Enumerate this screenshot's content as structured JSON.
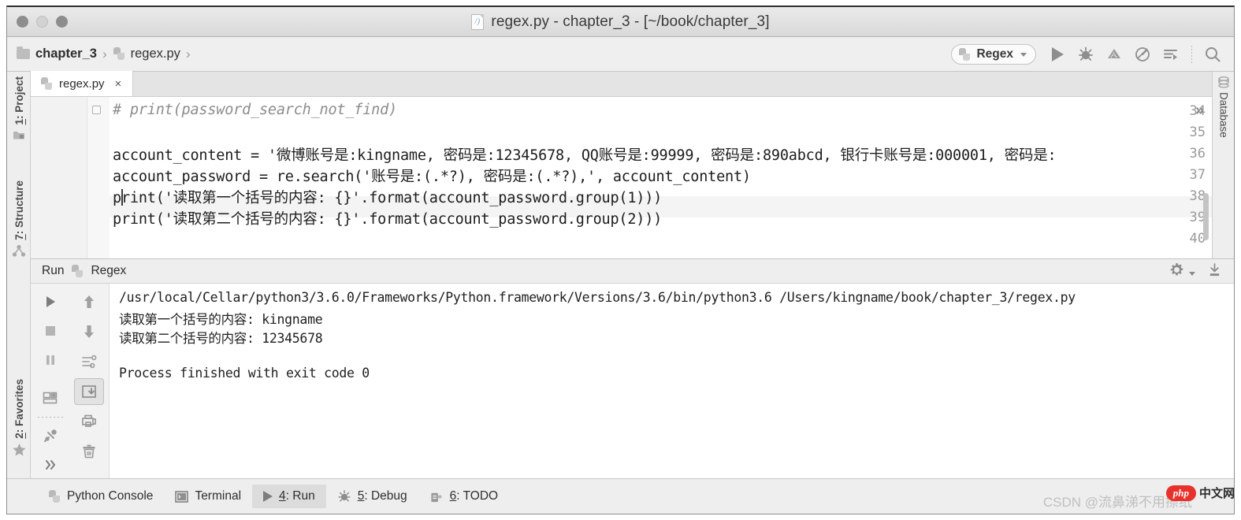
{
  "window": {
    "title": "regex.py - chapter_3 - [~/book/chapter_3]",
    "file_glyph_letter": "/)"
  },
  "breadcrumb": {
    "items": [
      {
        "label": "chapter_3",
        "icon": "folder-icon"
      },
      {
        "label": "regex.py",
        "icon": "python-file-icon"
      }
    ],
    "separator": "›"
  },
  "toolbar": {
    "run_config": "Regex",
    "icons": [
      "run-icon",
      "debug-icon",
      "coverage-icon",
      "profile-icon",
      "attach-to-process-icon",
      "search-everywhere-icon"
    ]
  },
  "sidebar_left": {
    "items": [
      {
        "num": "1",
        "label": ": Project",
        "icon": "project-icon"
      },
      {
        "num": "7",
        "label": ": Structure",
        "icon": "structure-icon"
      },
      {
        "num": "2",
        "label": ": Favorites",
        "icon": "star-icon"
      }
    ]
  },
  "sidebar_right": {
    "items": [
      {
        "label": "Database",
        "icon": "database-icon"
      }
    ]
  },
  "editor": {
    "tab": {
      "label": "regex.py",
      "close": "×"
    },
    "collapse_all": "»",
    "lines": [
      {
        "num": "34",
        "text": "# print(password_search_not_find)",
        "style": "comment"
      },
      {
        "num": "35",
        "text": "",
        "style": "code"
      },
      {
        "num": "36",
        "text": "account_content = '微博账号是:kingname, 密码是:12345678, QQ账号是:99999, 密码是:890abcd, 银行卡账号是:000001, 密码是:",
        "style": "code"
      },
      {
        "num": "37",
        "text": "account_password = re.search('账号是:(.*?), 密码是:(.*?),', account_content)",
        "style": "code"
      },
      {
        "num": "38",
        "text": "print('读取第一个括号的内容: {}'.format(account_password.group(1)))",
        "style": "code"
      },
      {
        "num": "39",
        "text": "print('读取第二个括号的内容: {}'.format(account_password.group(2)))",
        "style": "code"
      },
      {
        "num": "40",
        "text": "",
        "style": "code"
      }
    ]
  },
  "run_panel": {
    "title": "Run",
    "config_name": "Regex",
    "header_icons": [
      "settings-gear-icon",
      "export-to-file-icon"
    ],
    "tool_icons_left": [
      "rerun-icon",
      "stop-icon",
      "pause-icon",
      "print-icon",
      "pin-tab-icon",
      "expand-more-icon"
    ],
    "tool_icons_right": [
      "up-arrow-icon",
      "down-arrow-icon",
      "soft-wrap-icon",
      "scroll-to-end-icon",
      "print-console-icon",
      "clear-all-icon"
    ],
    "console_lines": [
      "/usr/local/Cellar/python3/3.6.0/Frameworks/Python.framework/Versions/3.6/bin/python3.6 /Users/kingname/book/chapter_3/regex.py",
      "读取第一个括号的内容: kingname",
      "读取第二个括号的内容: 12345678",
      "",
      "Process finished with exit code 0"
    ]
  },
  "statusbar": {
    "items": [
      {
        "num": "",
        "label": "Python Console",
        "icon": "python-icon",
        "active": false
      },
      {
        "num": "",
        "label": "Terminal",
        "icon": "terminal-icon",
        "active": false
      },
      {
        "num": "4",
        "label": ": Run",
        "icon": "run-icon",
        "active": true
      },
      {
        "num": "5",
        "label": ": Debug",
        "icon": "debug-icon",
        "active": false
      },
      {
        "num": "6",
        "label": ": TODO",
        "icon": "todo-icon",
        "active": false
      }
    ]
  },
  "watermarks": {
    "csdn": "CSDN @流鼻涕不用擦纸",
    "php_badge": "php",
    "php_cn": "中文网"
  },
  "colors": {
    "accent": "#8e8e8e",
    "watermark": "#bfbfbf",
    "php_red": "#e8312a"
  }
}
